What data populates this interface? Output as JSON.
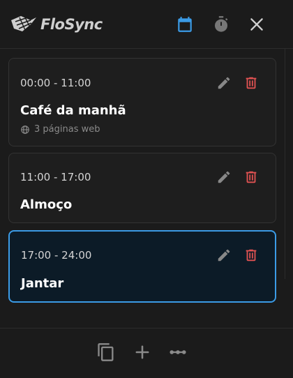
{
  "app": {
    "brand": "FloSync"
  },
  "header": {
    "icons": {
      "calendar": "calendar-icon",
      "timer": "stopwatch-icon",
      "close": "close-icon"
    }
  },
  "colors": {
    "accent": "#3b9be6",
    "delete": "#e05252",
    "background": "#1b1b1b",
    "card": "#1e1e1e",
    "active_card": "#0c1b27"
  },
  "slots": [
    {
      "time": "00:00 - 11:00",
      "title": "Café da manhã",
      "subtitle": "3 páginas web",
      "active": false
    },
    {
      "time": "11:00 - 17:00",
      "title": "Almoço",
      "subtitle": "",
      "active": false
    },
    {
      "time": "17:00 - 24:00",
      "title": "Jantar",
      "subtitle": "",
      "active": true
    }
  ],
  "footer": {
    "icons": [
      "copy-icon",
      "plus-icon",
      "more-icon"
    ]
  }
}
